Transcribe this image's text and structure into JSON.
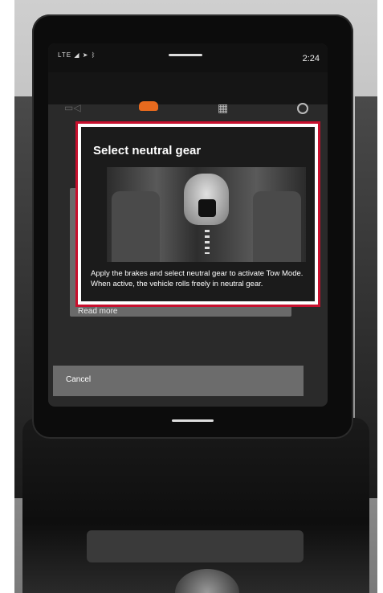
{
  "status_bar": {
    "signal_text": "LTE",
    "time": "2:24"
  },
  "nav": {
    "icons": [
      "camera-icon",
      "car-icon",
      "apps-grid-icon",
      "circle-icon"
    ]
  },
  "dialog": {
    "title": "Select neutral gear",
    "body": "Apply the brakes and select neutral gear to activate Tow Mode. When active, the vehicle rolls freely in neutral gear."
  },
  "background_panel": {
    "link_label": "Read more"
  },
  "actions": {
    "cancel_label": "Cancel"
  },
  "colors": {
    "accent": "#e86a1e",
    "highlight_outline": "#c8102e",
    "dialog_bg": "#1b1b1b"
  }
}
